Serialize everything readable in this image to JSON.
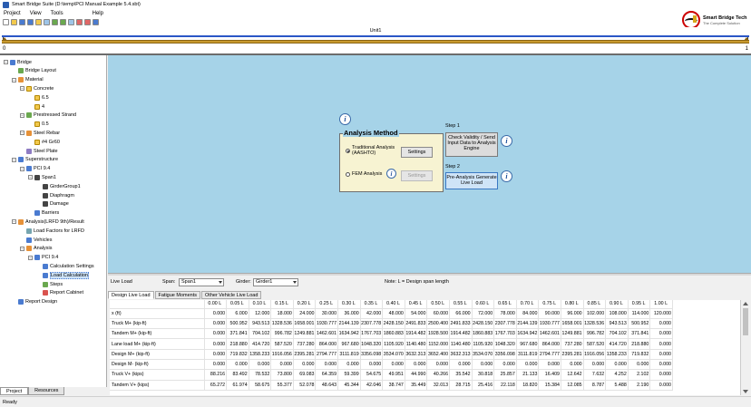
{
  "window": {
    "title": "Smart Bridge Suite (D:\\temp\\PCI Manual Example 5.4.sbt)"
  },
  "menu": [
    "Project",
    "View",
    "Tools",
    "Help"
  ],
  "toolbar": {
    "icons": [
      "new-icon",
      "open-icon",
      "save-icon",
      "save-as-icon",
      "folder-icon",
      "print-icon",
      "export-icon",
      "import-icon",
      "copy-icon",
      "undo-icon",
      "redo-icon",
      "refresh-icon"
    ]
  },
  "logo": {
    "name": "Smart Bridge Tech",
    "tagline": "The Complete Solution"
  },
  "unit": {
    "label": "Unit1",
    "start": "0",
    "end": "1"
  },
  "tree": [
    {
      "label": "Bridge",
      "level": 0
    },
    {
      "label": "Bridge Layout",
      "level": 1
    },
    {
      "label": "Material",
      "level": 1
    },
    {
      "label": "Concrete",
      "level": 2
    },
    {
      "label": "6.5",
      "level": 3
    },
    {
      "label": "4",
      "level": 3
    },
    {
      "label": "Prestressed Strand",
      "level": 2
    },
    {
      "label": "0.5",
      "level": 3
    },
    {
      "label": "Steel Rebar",
      "level": 2
    },
    {
      "label": "#4 Gr60",
      "level": 3
    },
    {
      "label": "Steel Plate",
      "level": 2
    },
    {
      "label": "Superstructure",
      "level": 1
    },
    {
      "label": "PCI 9.4",
      "level": 2
    },
    {
      "label": "Span1",
      "level": 3
    },
    {
      "label": "GirderGroup1",
      "level": 4
    },
    {
      "label": "Diaphragm",
      "level": 4
    },
    {
      "label": "Damage",
      "level": 4
    },
    {
      "label": "Barriers",
      "level": 3
    },
    {
      "label": "Analysis(LRFD 9th)/Result",
      "level": 1
    },
    {
      "label": "Load Factors for LRFD",
      "level": 2
    },
    {
      "label": "Vehicles",
      "level": 2
    },
    {
      "label": "Analysis",
      "level": 2
    },
    {
      "label": "PCI 9.4",
      "level": 3
    },
    {
      "label": "Calculation Settings",
      "level": 4
    },
    {
      "label": "Load Calculation",
      "level": 4
    },
    {
      "label": "Steps",
      "level": 4
    },
    {
      "label": "Report Cabinet",
      "level": 4
    },
    {
      "label": "Report Design",
      "level": 1
    }
  ],
  "panel_tabs": [
    "Project",
    "Resources"
  ],
  "analysis": {
    "method_title": "Analysis Method",
    "traditional": "Traditional Analysis\n(AASHTO)",
    "traditional_selected": true,
    "fem": "FEM Analysis",
    "settings": "Settings",
    "step1_label": "Step 1",
    "step1_button": "Check Validity / Send Input Data to Analysis Engine",
    "step2_label": "Step 2",
    "step2_button": "Pre-Analysis Generate Live Load"
  },
  "results": {
    "live_load_label": "Live Load",
    "span_label": "Span:",
    "span_value": "Span1",
    "girder_label": "Girder:",
    "girder_value": "Girder1",
    "note": "Note: L = Design span length",
    "tabs": [
      "Design Live Load",
      "Fatigue Moments",
      "Other Vehicle Live Load"
    ],
    "columns": [
      "0.00 L",
      "0.05 L",
      "0.10 L",
      "0.15 L",
      "0.20 L",
      "0.25 L",
      "0.30 L",
      "0.35 L",
      "0.40 L",
      "0.45 L",
      "0.50 L",
      "0.55 L",
      "0.60 L",
      "0.65 L",
      "0.70 L",
      "0.75 L",
      "0.80 L",
      "0.85 L",
      "0.90 L",
      "0.95 L",
      "1.00 L"
    ],
    "rows": [
      {
        "label": "x (ft)",
        "values": [
          "0.000",
          "6.000",
          "12.000",
          "18.000",
          "24.000",
          "30.000",
          "36.000",
          "42.000",
          "48.000",
          "54.000",
          "60.000",
          "66.000",
          "72.000",
          "78.000",
          "84.000",
          "90.000",
          "96.000",
          "102.000",
          "108.000",
          "114.000",
          "120.000"
        ]
      },
      {
        "label": "Truck M+ (kip-ft)",
        "values": [
          "0.000",
          "500.952",
          "943.513",
          "1328.536",
          "1658.001",
          "1930.777",
          "2144.139",
          "2307.778",
          "2428.150",
          "2491.833",
          "2500.400",
          "2491.833",
          "2428.150",
          "2307.778",
          "2144.139",
          "1930.777",
          "1658.001",
          "1328.536",
          "943.513",
          "500.952",
          "0.000"
        ]
      },
      {
        "label": "Tandem M+ (kip-ft)",
        "values": [
          "0.000",
          "371.841",
          "704.102",
          "996.782",
          "1249.881",
          "1462.601",
          "1634.942",
          "1767.703",
          "1860.883",
          "1914.482",
          "1928.500",
          "1914.482",
          "1860.883",
          "1767.703",
          "1634.942",
          "1462.601",
          "1249.881",
          "996.782",
          "704.102",
          "371.841",
          "0.000"
        ]
      },
      {
        "label": "Lane load M+ (kip-ft)",
        "values": [
          "0.000",
          "218.880",
          "414.720",
          "587.520",
          "737.280",
          "864.000",
          "967.680",
          "1048.320",
          "1105.920",
          "1140.480",
          "1152.000",
          "1140.480",
          "1105.920",
          "1048.320",
          "967.680",
          "864.000",
          "737.280",
          "587.520",
          "414.720",
          "218.880",
          "0.000"
        ]
      },
      {
        "label": "Design M+ (kip-ft)",
        "values": [
          "0.000",
          "719.832",
          "1358.233",
          "1916.056",
          "2395.281",
          "2794.777",
          "3111.819",
          "3356.098",
          "3534.070",
          "3632.313",
          "3652.400",
          "3632.313",
          "3534.070",
          "3356.098",
          "3111.819",
          "2794.777",
          "2395.281",
          "1916.056",
          "1358.233",
          "719.832",
          "0.000"
        ]
      },
      {
        "label": "Design M- (kip-ft)",
        "values": [
          "0.000",
          "0.000",
          "0.000",
          "0.000",
          "0.000",
          "0.000",
          "0.000",
          "0.000",
          "0.000",
          "0.000",
          "0.000",
          "0.000",
          "0.000",
          "0.000",
          "0.000",
          "0.000",
          "0.000",
          "0.000",
          "0.000",
          "0.000",
          "0.000"
        ]
      },
      {
        "label": "Truck V+ (kips)",
        "values": [
          "88.216",
          "83.492",
          "78.532",
          "73.800",
          "69.083",
          "64.359",
          "59.399",
          "54.675",
          "49.951",
          "44.990",
          "40.266",
          "35.542",
          "30.818",
          "25.857",
          "21.133",
          "16.409",
          "12.642",
          "7.632",
          "4.252",
          "2.102",
          "0.000"
        ]
      },
      {
        "label": "Tandem V+ (kips)",
        "values": [
          "65.272",
          "61.974",
          "58.675",
          "55.377",
          "52.078",
          "48.643",
          "45.344",
          "42.046",
          "38.747",
          "35.449",
          "32.013",
          "28.715",
          "25.416",
          "22.118",
          "18.820",
          "15.384",
          "12.085",
          "8.787",
          "5.488",
          "2.190",
          "0.000"
        ]
      }
    ]
  },
  "status": "Ready"
}
